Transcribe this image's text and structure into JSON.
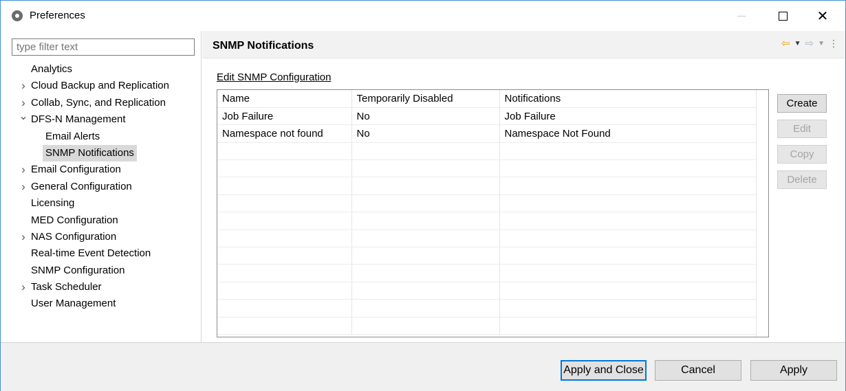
{
  "window": {
    "title": "Preferences",
    "icons": {
      "app": "app-logo-icon",
      "minimize": "minimize-icon",
      "maximize": "maximize-icon",
      "close": "close-icon"
    },
    "close_glyph": "✕"
  },
  "sidebar": {
    "filter_placeholder": "type filter text",
    "items": [
      {
        "label": "Analytics",
        "expandable": false,
        "indent": 0
      },
      {
        "label": "Cloud Backup and Replication",
        "expandable": true,
        "expanded": false,
        "indent": 0
      },
      {
        "label": "Collab, Sync, and Replication",
        "expandable": true,
        "expanded": false,
        "indent": 0
      },
      {
        "label": "DFS-N Management",
        "expandable": true,
        "expanded": true,
        "indent": 0
      },
      {
        "label": "Email Alerts",
        "expandable": false,
        "indent": 1
      },
      {
        "label": "SNMP Notifications",
        "expandable": false,
        "indent": 1,
        "selected": true
      },
      {
        "label": "Email Configuration",
        "expandable": true,
        "expanded": false,
        "indent": 0
      },
      {
        "label": "General Configuration",
        "expandable": true,
        "expanded": false,
        "indent": 0
      },
      {
        "label": "Licensing",
        "expandable": false,
        "indent": 0
      },
      {
        "label": "MED Configuration",
        "expandable": false,
        "indent": 0
      },
      {
        "label": "NAS Configuration",
        "expandable": true,
        "expanded": false,
        "indent": 0
      },
      {
        "label": "Real-time Event Detection",
        "expandable": false,
        "indent": 0
      },
      {
        "label": "SNMP Configuration",
        "expandable": false,
        "indent": 0
      },
      {
        "label": "Task Scheduler",
        "expandable": true,
        "expanded": false,
        "indent": 0
      },
      {
        "label": "User Management",
        "expandable": false,
        "indent": 0
      }
    ]
  },
  "main": {
    "title": "SNMP Notifications",
    "section_link": "Edit SNMP Configuration",
    "nav": {
      "back_icon": "back-arrow-icon",
      "forward_icon": "forward-arrow-icon",
      "menu_icon": "view-menu-icon"
    },
    "table": {
      "columns": [
        "Name",
        "Temporarily Disabled",
        "Notifications"
      ],
      "rows": [
        [
          "Job Failure",
          "No",
          "Job Failure"
        ],
        [
          "Namespace not found",
          "No",
          "Namespace Not Found"
        ]
      ],
      "empty_rows": 11
    },
    "buttons": [
      {
        "label": "Create",
        "enabled": true
      },
      {
        "label": "Edit",
        "enabled": false
      },
      {
        "label": "Copy",
        "enabled": false
      },
      {
        "label": "Delete",
        "enabled": false
      }
    ]
  },
  "footer": {
    "apply_close_label": "Apply and Close",
    "cancel_label": "Cancel",
    "apply_label": "Apply"
  },
  "colors": {
    "accent": "#0078d7",
    "back_arrow": "#e8a400",
    "selected_bg": "#d9d9d9"
  }
}
